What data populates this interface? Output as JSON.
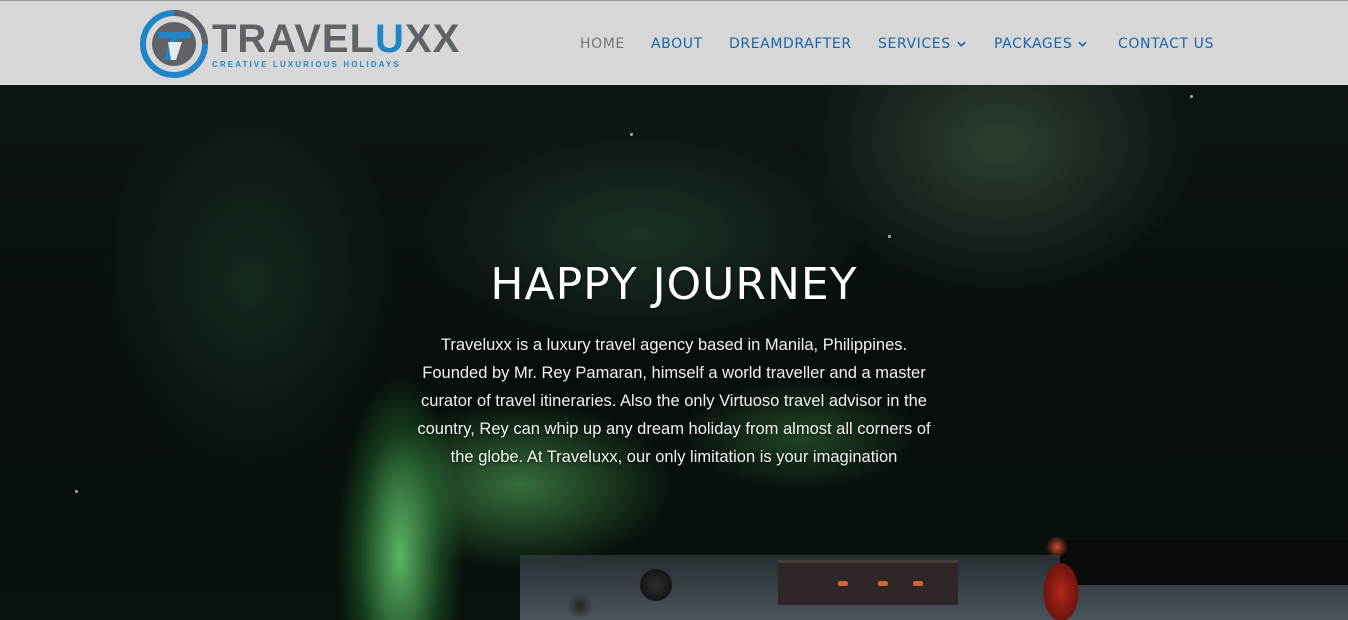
{
  "brand": {
    "name_part1": "TRAVEL",
    "name_part2": "U",
    "name_part3": "XX",
    "tagline": "CREATIVE LUXURIOUS HOLIDAYS",
    "colors": {
      "blue": "#1f84c8",
      "gray": "#5f6266"
    }
  },
  "nav": {
    "items": [
      {
        "label": "HOME",
        "active": true
      },
      {
        "label": "ABOUT"
      },
      {
        "label": "DREAMDRAFTER"
      },
      {
        "label": "SERVICES",
        "dropdown": true
      },
      {
        "label": "PACKAGES",
        "dropdown": true
      },
      {
        "label": "CONTACT US"
      }
    ],
    "colors": {
      "link": "#1a66ac",
      "active": "#777777",
      "bar": "#d7d7d7"
    }
  },
  "hero": {
    "title": "HAPPY JOURNEY",
    "text": "Traveluxx is a luxury travel agency based in Manila, Philippines. Founded by Mr. Rey Pamaran, himself a world traveller and a master curator of travel itineraries. Also the only Virtuoso travel advisor in the country, Rey can whip up any dream holiday from almost all corners of the globe. At Traveluxx, our only limitation is your imagination",
    "background": "aurora-borealis-night-photo"
  }
}
